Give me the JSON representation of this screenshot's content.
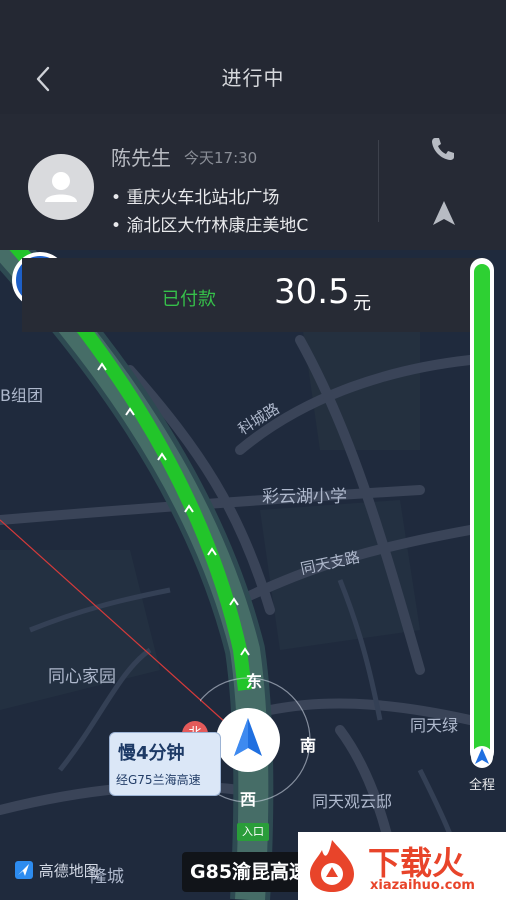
{
  "header": {
    "title": "进行中",
    "back_icon": "chevron-left-icon"
  },
  "passenger": {
    "name": "陈先生",
    "time": "今天17:30",
    "pickup": "重庆火车北站北广场",
    "dropoff": "渝北区大竹林康庄美地C"
  },
  "payment": {
    "status": "已付款",
    "amount": "30.5",
    "unit": "元"
  },
  "map": {
    "labels": [
      "B组团",
      "科城路",
      "彩云湖小学",
      "同天支路",
      "同心家园",
      "同天观云邸",
      "同天绿",
      "隆城"
    ],
    "compass": {
      "east": "东",
      "south": "南",
      "west": "西",
      "north_badge": "北"
    },
    "route_bubble": {
      "main": "慢4分钟",
      "sub": "经G75兰海高速"
    },
    "entrance_label": "入口",
    "current_road": "G85渝昆高速",
    "overview_label": "全程",
    "logo": "高德地图"
  },
  "watermark": {
    "brand": "下载火",
    "site": "xiazaihuo.com"
  },
  "colors": {
    "accent_green": "#36c04a",
    "traffic_green": "#2ed033",
    "header_bg": "#242833"
  }
}
